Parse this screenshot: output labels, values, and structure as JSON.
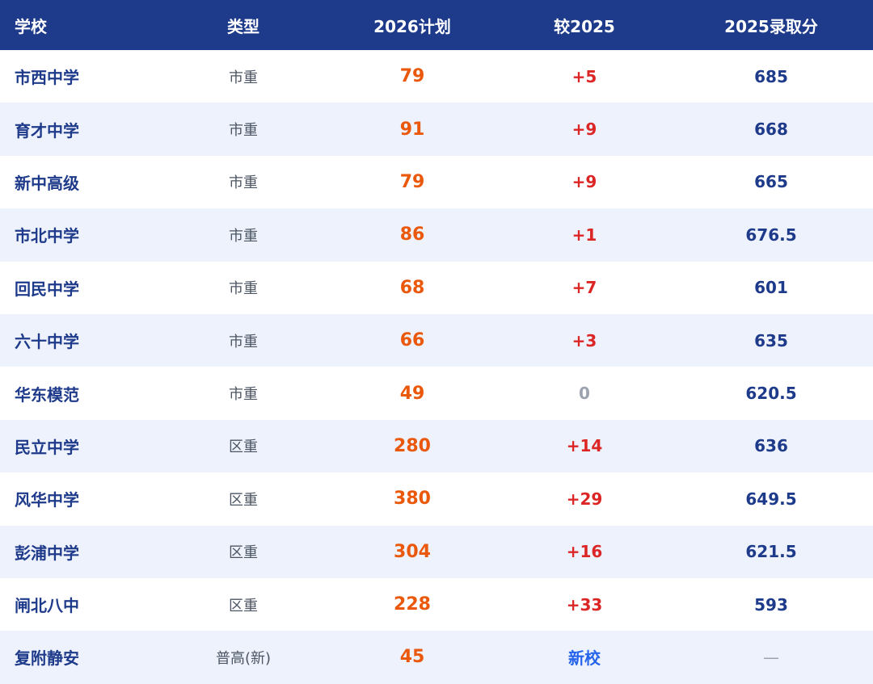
{
  "header": {
    "school": "学校",
    "type": "类型",
    "plan_2026": "2026计划",
    "vs_2025": "较2025",
    "score_2025": "2025录取分"
  },
  "rows": [
    {
      "school": "市西中学",
      "type": "市重",
      "plan": "79",
      "delta": "+5",
      "score": "685"
    },
    {
      "school": "育才中学",
      "type": "市重",
      "plan": "91",
      "delta": "+9",
      "score": "668"
    },
    {
      "school": "新中高级",
      "type": "市重",
      "plan": "79",
      "delta": "+9",
      "score": "665"
    },
    {
      "school": "市北中学",
      "type": "市重",
      "plan": "86",
      "delta": "+1",
      "score": "676.5"
    },
    {
      "school": "回民中学",
      "type": "市重",
      "plan": "68",
      "delta": "+7",
      "score": "601"
    },
    {
      "school": "六十中学",
      "type": "市重",
      "plan": "66",
      "delta": "+3",
      "score": "635"
    },
    {
      "school": "华东模范",
      "type": "市重",
      "plan": "49",
      "delta": "0",
      "score": "620.5"
    },
    {
      "school": "民立中学",
      "type": "区重",
      "plan": "280",
      "delta": "+14",
      "score": "636"
    },
    {
      "school": "风华中学",
      "type": "区重",
      "plan": "380",
      "delta": "+29",
      "score": "649.5"
    },
    {
      "school": "彭浦中学",
      "type": "区重",
      "plan": "304",
      "delta": "+16",
      "score": "621.5"
    },
    {
      "school": "闸北八中",
      "type": "区重",
      "plan": "228",
      "delta": "+33",
      "score": "593"
    },
    {
      "school": "复附静安",
      "type": "普高(新)",
      "plan": "45",
      "delta": "新校",
      "score": "—"
    }
  ],
  "colors": {
    "header_bg": "#1e3a8a",
    "school_text": "#1e3a8a",
    "plan_text": "#ea580c",
    "delta_positive": "#dc2626",
    "delta_zero": "#9ca3af",
    "delta_new": "#2563eb",
    "row_alt_bg": "#eef2fc"
  }
}
